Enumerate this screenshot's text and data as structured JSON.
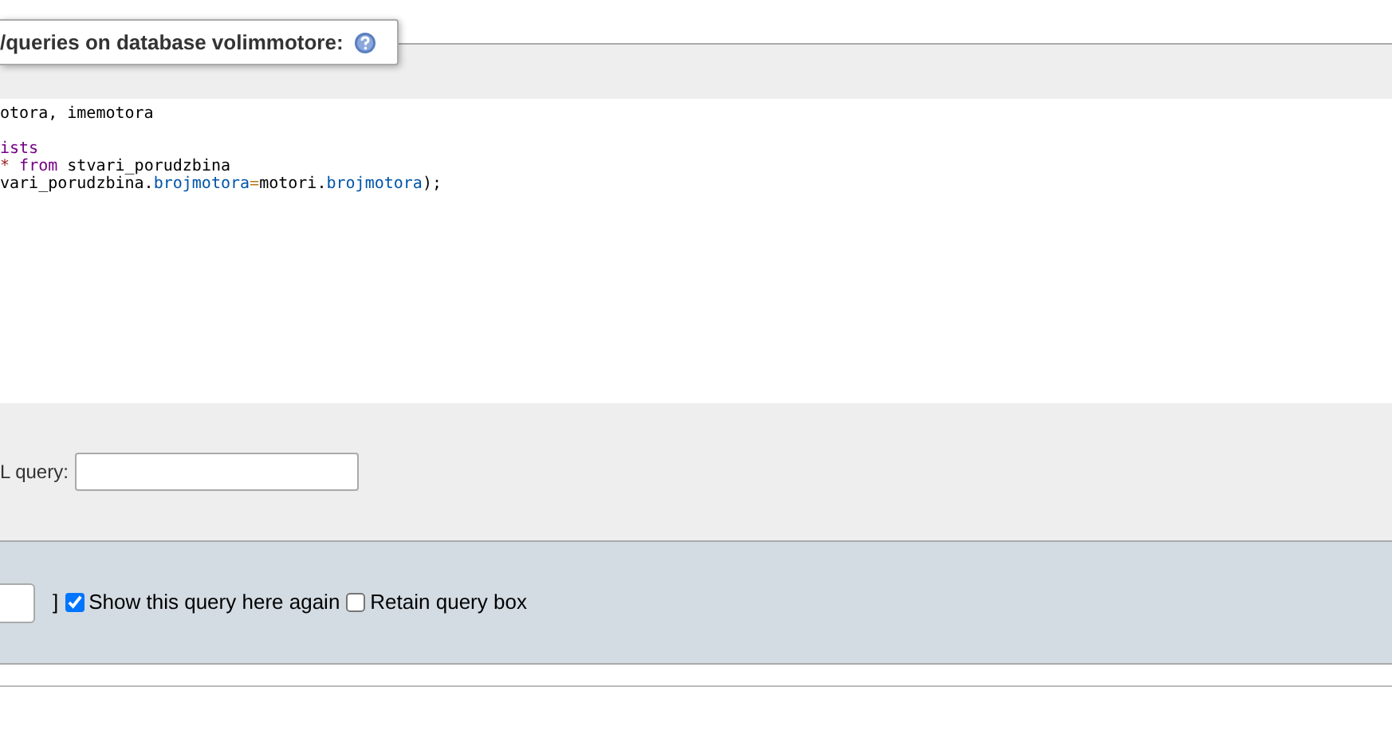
{
  "legend": {
    "title": "/queries on database volimmotore:"
  },
  "code_lines": [
    {
      "kind": "code",
      "tokens": [
        {
          "kind": "plain",
          "text": "otora, imemotora"
        }
      ]
    },
    {
      "kind": "blank"
    },
    {
      "kind": "code",
      "tokens": [
        {
          "kind": "keyword",
          "text": "ists"
        }
      ]
    },
    {
      "kind": "code",
      "tokens": [
        {
          "kind": "operator",
          "text": "* "
        },
        {
          "kind": "keyword",
          "text": "from"
        },
        {
          "kind": "plain",
          "text": " stvari_porudzbina"
        }
      ]
    },
    {
      "kind": "code",
      "tokens": [
        {
          "kind": "plain",
          "text": "vari_porudzbina."
        },
        {
          "kind": "column",
          "text": "brojmotora"
        },
        {
          "kind": "equals",
          "text": "="
        },
        {
          "kind": "plain",
          "text": "motori."
        },
        {
          "kind": "column",
          "text": "brojmotora"
        },
        {
          "kind": "plain",
          "text": ");"
        }
      ]
    }
  ],
  "bookmark": {
    "label": "L query:"
  },
  "options": {
    "bracket": "]",
    "checkboxes": [
      {
        "label": "Show this query here again",
        "checked": true
      },
      {
        "label": "Retain query box",
        "checked": false
      }
    ]
  }
}
